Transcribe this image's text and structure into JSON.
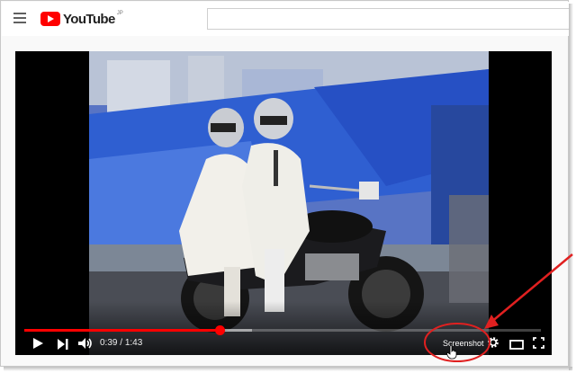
{
  "masthead": {
    "logo_text": "YouTube",
    "logo_region": "JP",
    "search_placeholder": ""
  },
  "player": {
    "current_time": "0:39",
    "duration": "1:43",
    "time_separator": " / ",
    "progress_played_fraction": 0.378,
    "progress_loaded_fraction": 0.44,
    "screenshot_label": "Screenshot"
  },
  "icons": {
    "menu": "hamburger-menu-icon",
    "play": "play-icon",
    "next": "next-icon",
    "volume": "volume-icon",
    "settings": "gear-icon",
    "theater": "theater-mode-icon",
    "fullscreen": "fullscreen-icon",
    "cursor": "hand-cursor-icon"
  },
  "colors": {
    "brand_red": "#ff0000",
    "annotation_red": "#e02020",
    "player_bg": "#000000"
  }
}
